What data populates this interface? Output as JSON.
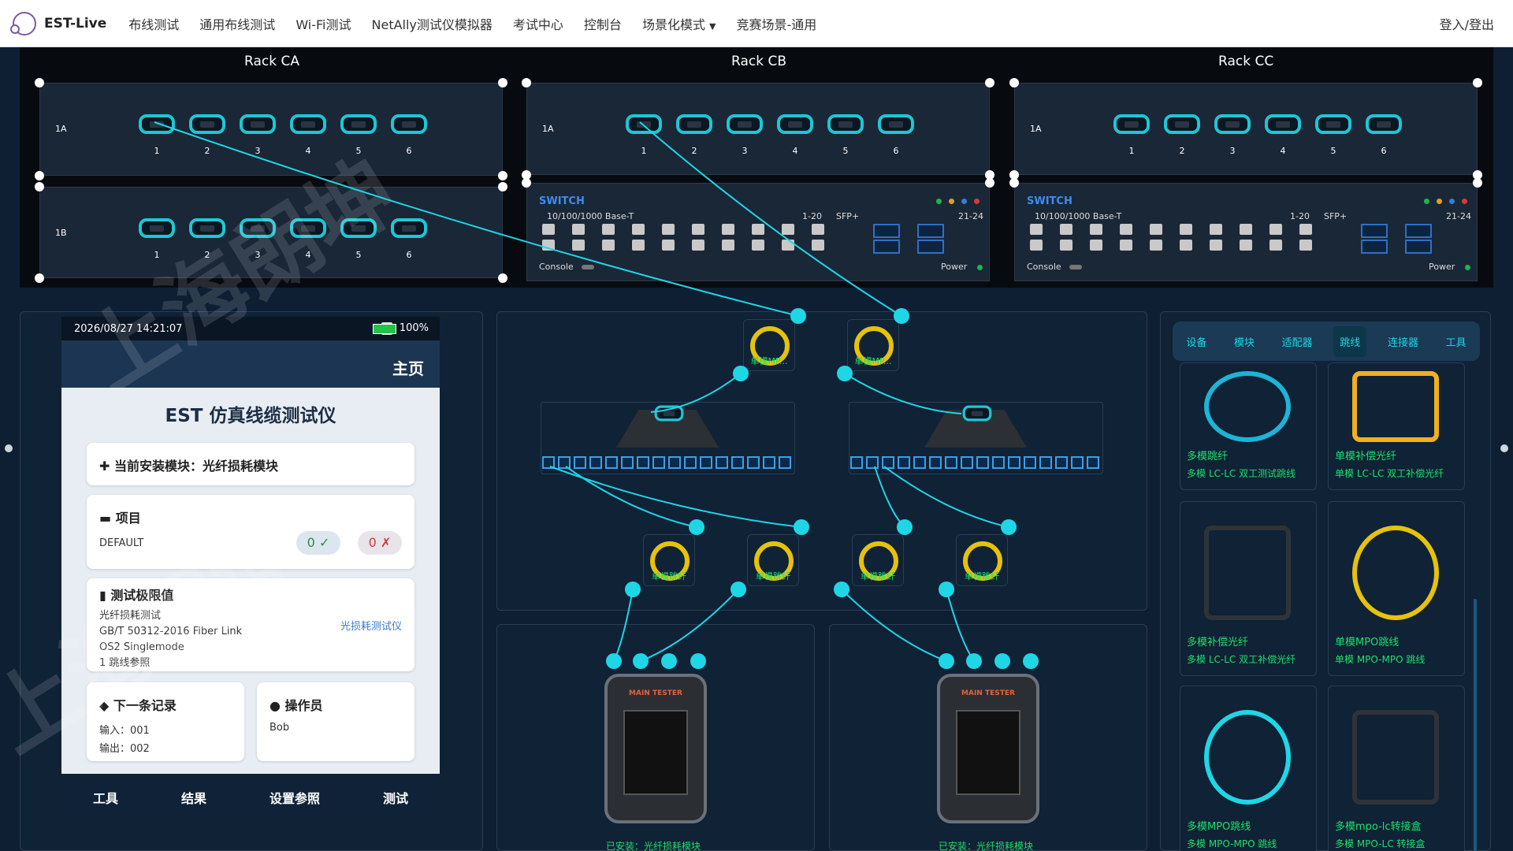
{
  "nav": {
    "logo": "EST-Live",
    "items": [
      "布线测试",
      "通用布线测试",
      "Wi-Fi测试",
      "NetAlly测试仪模拟器",
      "考试中心",
      "控制台",
      "场景化模式",
      "竞赛场景-通用"
    ],
    "login": "登入/登出"
  },
  "racks": [
    {
      "title": "Rack CA",
      "panels": [
        {
          "label": "1A",
          "ports": [
            "1",
            "2",
            "3",
            "4",
            "5",
            "6"
          ]
        },
        {
          "label": "1B",
          "ports": [
            "1",
            "2",
            "3",
            "4",
            "5",
            "6"
          ]
        }
      ]
    },
    {
      "title": "Rack CB",
      "panels": [
        {
          "label": "1A",
          "ports": [
            "1",
            "2",
            "3",
            "4",
            "5",
            "6"
          ]
        }
      ]
    },
    {
      "title": "Rack CC",
      "panels": [
        {
          "label": "1A",
          "ports": [
            "1",
            "2",
            "3",
            "4",
            "5",
            "6"
          ]
        }
      ]
    }
  ],
  "switch": {
    "title": "SWITCH",
    "base": "10/100/1000 Base-T",
    "range1": "1-20",
    "sfp": "SFP+",
    "range2": "21-24",
    "console": "Console",
    "power": "Power"
  },
  "device": {
    "datetime": "2026/08/27 14:21:07",
    "battery": "100%",
    "home": "主页",
    "title": "EST 仿真线缆测试仪",
    "module_label": "当前安装模块：光纤损耗模块",
    "project_title": "项目",
    "project_value": "DEFAULT",
    "pass_count": "0",
    "fail_count": "0",
    "limit_title": "测试极限值",
    "limit_lines": [
      "光纤损耗测试",
      "GB/T 50312-2016 Fiber Link",
      "OS2 Singlemode",
      "1 跳线参照"
    ],
    "limit_link": "光损耗测试仪",
    "next_title": "下一条记录",
    "next_in": "输入：001",
    "next_out": "输出：002",
    "op_title": "操作员",
    "op_value": "Bob",
    "bottom": [
      "工具",
      "结果",
      "设置参照",
      "测试"
    ]
  },
  "canvas": {
    "spool_top": [
      "单模MP...",
      "单模MP..."
    ],
    "spool_mid": [
      "单模跳纤",
      "单模跳纤",
      "单模跳纤",
      "单模跳纤"
    ],
    "tester_header": "MAIN TESTER",
    "installed": "已安装：光纤损耗模块"
  },
  "sidebar": {
    "tabs": [
      "设备",
      "模块",
      "适配器",
      "跳线",
      "连接器",
      "工具"
    ],
    "active_tab": "跳线",
    "items": [
      {
        "name": "多模跳纤",
        "desc": "多模 LC-LC 双工测试跳线"
      },
      {
        "name": "单模补偿光纤",
        "desc": "单模 LC-LC 双工补偿光纤"
      },
      {
        "name": "多模补偿光纤",
        "desc": "多模 LC-LC 双工补偿光纤"
      },
      {
        "name": "单模MPO跳线",
        "desc": "单模 MPO-MPO 跳线"
      },
      {
        "name": "多模MPO跳线",
        "desc": "多模 MPO-MPO 跳线"
      },
      {
        "name": "多模mpo-lc转接盒",
        "desc": "多模 MPO-LC 转接盒"
      }
    ]
  },
  "watermark": [
    "上海朗坤",
    "上海朗坤"
  ],
  "colors": {
    "accent": "#1fd6e6",
    "good": "#1fe06a",
    "bg": "#0e1f33"
  }
}
